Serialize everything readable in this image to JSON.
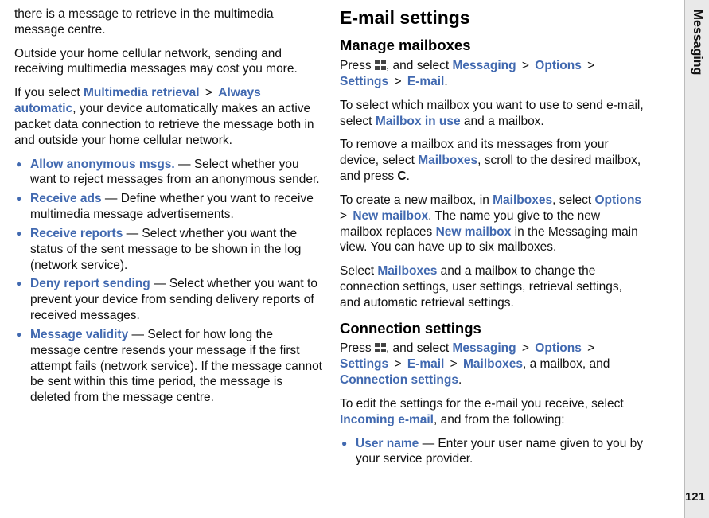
{
  "sidebar": {
    "label": "Messaging"
  },
  "page_number": "121",
  "left_col": {
    "p1": "there is a message to retrieve in the multimedia message centre.",
    "p2": "Outside your home cellular network, sending and receiving multimedia messages may cost you more.",
    "p3a": "If you select ",
    "p3_link1": "Multimedia retrieval",
    "p3_sep": " > ",
    "p3_link2": "Always automatic",
    "p3b": ", your device automatically makes an active packet data connection to retrieve the message both in and outside your home cellular network.",
    "bullets": [
      {
        "term": "Allow anonymous msgs.",
        "desc": " — Select whether you want to reject messages from an anonymous sender."
      },
      {
        "term": "Receive ads",
        "desc": " — Define whether you want to receive multimedia message advertisements."
      },
      {
        "term": "Receive reports",
        "desc": " — Select whether you want the status of the sent message to be shown in the log (network service)."
      },
      {
        "term": "Deny report sending",
        "desc": " — Select whether you want to prevent your device from sending delivery reports of received messages."
      },
      {
        "term": "Message validity",
        "desc": " — Select for how long the message centre resends your message if the first attempt fails (network service). If the message cannot be sent within this time period, the message is deleted from the message centre."
      }
    ]
  },
  "right_col": {
    "h1": "E-mail settings",
    "h2a": "Manage mailboxes",
    "p1a": "Press ",
    "p1b": ", and select ",
    "p1_path": [
      "Messaging",
      "Options",
      "Settings",
      "E-mail"
    ],
    "p1_end": ".",
    "p2a": "To select which mailbox you want to use to send e-mail, select ",
    "p2_link": "Mailbox in use",
    "p2b": " and a mailbox.",
    "p3a": "To remove a mailbox and its messages from your device, select ",
    "p3_link": "Mailboxes",
    "p3b": ", scroll to the desired mailbox, and press ",
    "p3_key": "C",
    "p3c": ".",
    "p4a": "To create a new mailbox, in ",
    "p4_link1": "Mailboxes",
    "p4b": ", select ",
    "p4_link2": "Options",
    "p4_sep": " > ",
    "p4_link3": "New mailbox",
    "p4c": ". The name you give to the new mailbox replaces ",
    "p4_link4": "New mailbox",
    "p4d": " in the Messaging main view. You can have up to six mailboxes.",
    "p5a": "Select ",
    "p5_link": "Mailboxes",
    "p5b": " and a mailbox to change the connection settings, user settings, retrieval settings, and automatic retrieval settings.",
    "h2b": "Connection settings",
    "p6a": "Press ",
    "p6b": ", and select ",
    "p6_path": [
      "Messaging",
      "Options",
      "Settings",
      "E-mail",
      "Mailboxes"
    ],
    "p6c": ", a mailbox, and ",
    "p6_link_last": "Connection settings",
    "p6d": ".",
    "p7a": "To edit the settings for the e-mail you receive, select ",
    "p7_link": "Incoming e-mail",
    "p7b": ", and from the following:",
    "bullets": [
      {
        "term": "User name",
        "desc": " — Enter your user name given to you by your service provider."
      }
    ]
  }
}
